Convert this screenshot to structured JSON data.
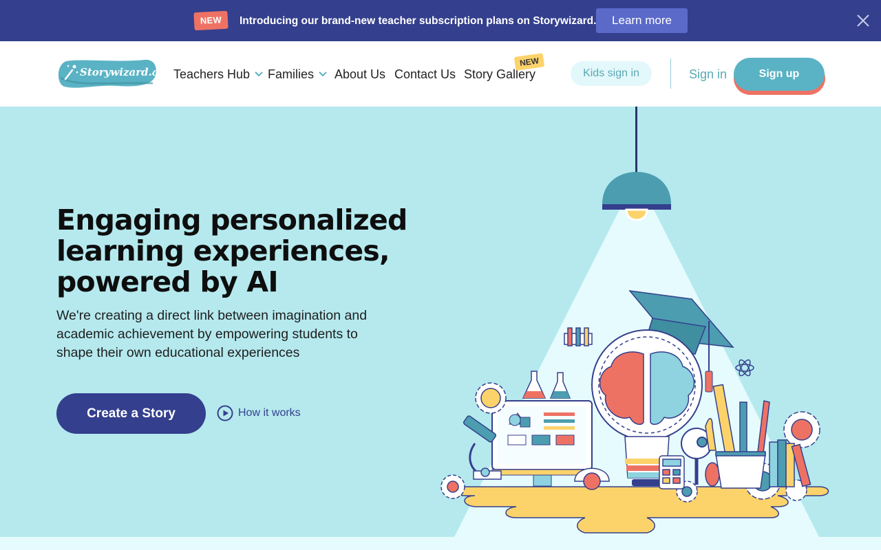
{
  "announcement": {
    "badge": "NEW",
    "text": "Introducing our brand-new teacher subscription plans on Storywizard.ai",
    "cta": "Learn more",
    "close_icon": "close-icon"
  },
  "nav": {
    "logo_text": "Storywizard.ai",
    "items": [
      {
        "label": "Teachers Hub",
        "has_dropdown": true
      },
      {
        "label": "Families",
        "has_dropdown": true
      },
      {
        "label": "About Us",
        "has_dropdown": false
      },
      {
        "label": "Contact Us",
        "has_dropdown": false
      },
      {
        "label": "Story Gallery",
        "has_dropdown": false,
        "badge": "NEW"
      }
    ],
    "kids_sign_in": "Kids sign in",
    "sign_in": "Sign in",
    "sign_up": "Sign up"
  },
  "hero": {
    "title": "Engaging personalized learning experiences, powered by AI",
    "subtitle": "We're creating a direct link between imagination and academic achievement by empowering students to shape their own educational experiences",
    "primary_cta": "Create a Story",
    "secondary_cta": "How it works",
    "secondary_icon": "play-circle-icon",
    "illustration": "lamp-lightbulb-brain-education-illustration"
  },
  "colors": {
    "navy": "#343f8d",
    "teal": "#5ab3c4",
    "coral": "#ee7264",
    "hero_bg": "#b5e9ee",
    "yellow": "#fcd36b"
  }
}
